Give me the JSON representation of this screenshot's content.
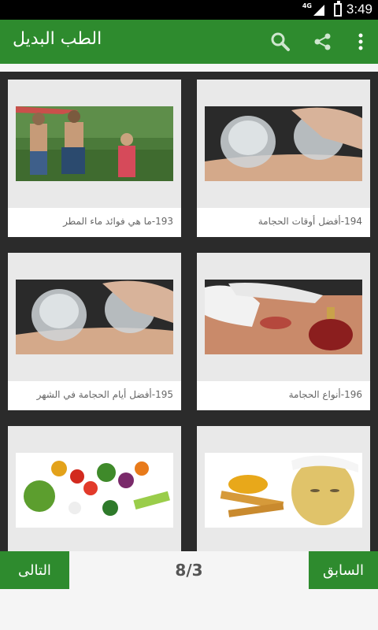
{
  "status_bar": {
    "time": "3:49",
    "network": "4G"
  },
  "app_bar": {
    "title": "الطب البديل"
  },
  "cards": [
    {
      "caption": "193-ما هي فوائد ماء المطر"
    },
    {
      "caption": "194-أفضل أوقات الحجامة"
    },
    {
      "caption": "195-أفضل أيام الحجامة في الشهر"
    },
    {
      "caption": "196-أنواع الحجامة"
    },
    {
      "caption": ""
    },
    {
      "caption": ""
    }
  ],
  "pagination": {
    "next_label": "التالى",
    "prev_label": "السابق",
    "indicator": "8/3"
  },
  "colors": {
    "primary": "#2e8b2e",
    "background": "#2b2b2b"
  },
  "icons": [
    "search-icon",
    "share-icon",
    "more-vert-icon"
  ]
}
